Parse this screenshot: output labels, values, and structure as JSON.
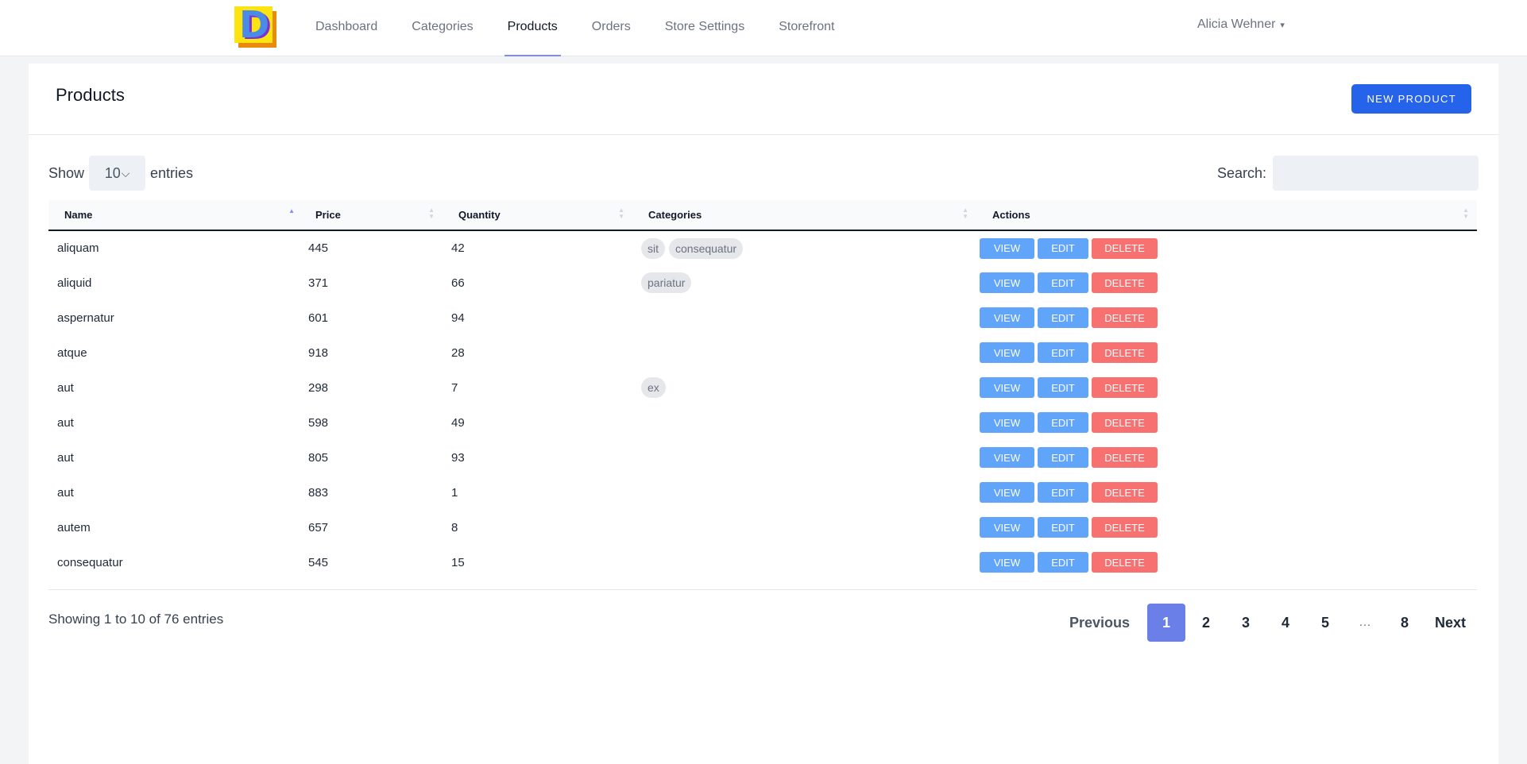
{
  "nav": {
    "logo_letter": "D",
    "items": [
      {
        "label": "Dashboard",
        "active": false
      },
      {
        "label": "Categories",
        "active": false
      },
      {
        "label": "Products",
        "active": true
      },
      {
        "label": "Orders",
        "active": false
      },
      {
        "label": "Store Settings",
        "active": false
      },
      {
        "label": "Storefront",
        "active": false
      }
    ],
    "user_name": "Alicia Wehner",
    "user_chevron": "⌄"
  },
  "header": {
    "title": "Products",
    "new_button": "NEW PRODUCT"
  },
  "controls": {
    "show_label": "Show",
    "page_length": "10",
    "entries_label": "entries",
    "search_label": "Search:",
    "search_value": "",
    "search_placeholder": ""
  },
  "table": {
    "columns": [
      "Name",
      "Price",
      "Quantity",
      "Categories",
      "Actions"
    ],
    "sorted_column": "Name",
    "sort_direction": "asc",
    "action_labels": {
      "view": "VIEW",
      "edit": "EDIT",
      "delete": "DELETE"
    },
    "rows": [
      {
        "name": "aliquam",
        "price": "445",
        "quantity": "42",
        "categories": [
          "sit",
          "consequatur"
        ]
      },
      {
        "name": "aliquid",
        "price": "371",
        "quantity": "66",
        "categories": [
          "pariatur"
        ]
      },
      {
        "name": "aspernatur",
        "price": "601",
        "quantity": "94",
        "categories": []
      },
      {
        "name": "atque",
        "price": "918",
        "quantity": "28",
        "categories": []
      },
      {
        "name": "aut",
        "price": "298",
        "quantity": "7",
        "categories": [
          "ex"
        ]
      },
      {
        "name": "aut",
        "price": "598",
        "quantity": "49",
        "categories": []
      },
      {
        "name": "aut",
        "price": "805",
        "quantity": "93",
        "categories": []
      },
      {
        "name": "aut",
        "price": "883",
        "quantity": "1",
        "categories": []
      },
      {
        "name": "autem",
        "price": "657",
        "quantity": "8",
        "categories": []
      },
      {
        "name": "consequatur",
        "price": "545",
        "quantity": "15",
        "categories": []
      }
    ]
  },
  "footer": {
    "info": "Showing 1 to 10 of 76 entries",
    "previous": "Previous",
    "next": "Next",
    "pages": [
      "1",
      "2",
      "3",
      "4",
      "5",
      "…",
      "8"
    ],
    "current_page": "1"
  },
  "colors": {
    "primary": "#2563eb",
    "view_button": "#60a5fa",
    "delete_button": "#f87171",
    "current_page": "#6b7fe8",
    "nav_active_underline": "#818cf8"
  }
}
